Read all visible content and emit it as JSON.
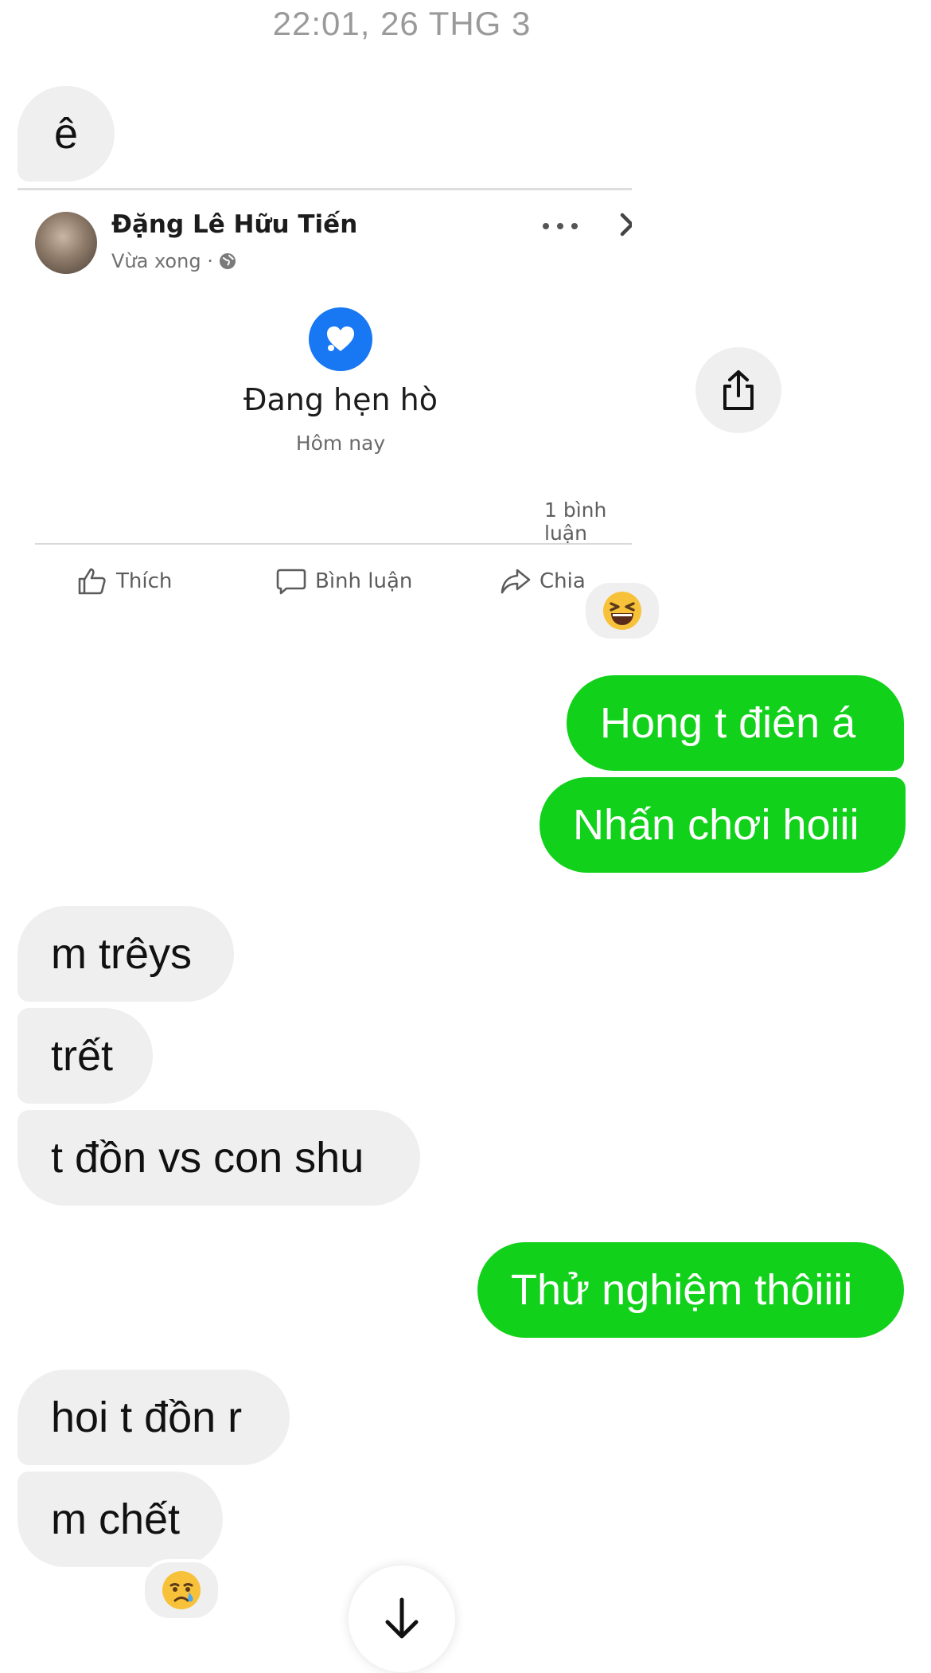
{
  "thread": {
    "timestamp": "22:01, 26 THG 3"
  },
  "messages": [
    {
      "side": "in",
      "text": "ê"
    },
    {
      "side": "out",
      "text": "Hong t điên á"
    },
    {
      "side": "out",
      "text": "Nhấn chơi hoiii"
    },
    {
      "side": "in",
      "text": "m trêys"
    },
    {
      "side": "in",
      "text": "trết"
    },
    {
      "side": "in",
      "text": "t đồn vs con shu"
    },
    {
      "side": "out",
      "text": "Thử nghiệm thôiiii"
    },
    {
      "side": "in",
      "text": "hoi t đồn r"
    },
    {
      "side": "in",
      "text": "m chết"
    }
  ],
  "shared_post": {
    "author": "Đặng Lê Hữu Tiến",
    "meta": "Vừa xong ·",
    "status_title": "Đang hẹn hò",
    "status_sub": "Hôm nay",
    "comment_count": "1 bình luận",
    "actions": {
      "like": "Thích",
      "comment": "Bình luận",
      "share": "Chia"
    },
    "reaction_emoji": "grinning-squinting-face"
  },
  "last_message_reaction": "crying-face",
  "colors": {
    "outgoing_bubble": "#12d11b",
    "incoming_bubble": "#efefef",
    "facebook_blue": "#1877f2"
  }
}
